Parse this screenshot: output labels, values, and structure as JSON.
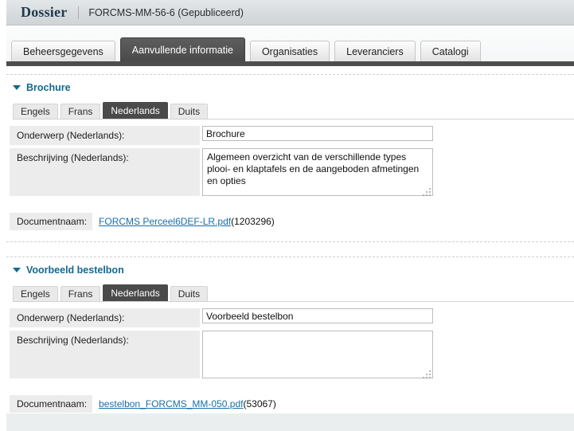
{
  "header": {
    "title": "Dossier",
    "subtitle": "FORCMS-MM-56-6 (Gepubliceerd)"
  },
  "tabs": [
    {
      "label": "Beheersgegevens",
      "active": false
    },
    {
      "label": "Aanvullende informatie",
      "active": true
    },
    {
      "label": "Organisaties",
      "active": false
    },
    {
      "label": "Leveranciers",
      "active": false
    },
    {
      "label": "Catalogi",
      "active": false
    }
  ],
  "language_tabs": [
    "Engels",
    "Frans",
    "Nederlands",
    "Duits"
  ],
  "active_language_tab": "Nederlands",
  "sections": [
    {
      "title": "Brochure",
      "langtabs": [
        "Engels",
        "Frans",
        "Nederlands",
        "Duits"
      ],
      "active_langtab": "Nederlands",
      "subject_label": "Onderwerp (Nederlands):",
      "subject_value": "Brochure",
      "description_label": "Beschrijving (Nederlands):",
      "description_value": "Algemeen overzicht van de verschillende types plooi- en klaptafels en de aangeboden afmetingen en opties",
      "document_label": "Documentnaam:",
      "document_link": "FORCMS Perceel6DEF-LR.pdf",
      "document_size": "(1203296)"
    },
    {
      "title": "Voorbeeld bestelbon",
      "langtabs": [
        "Engels",
        "Frans",
        "Nederlands",
        "Duits"
      ],
      "active_langtab": "Nederlands",
      "subject_label": "Onderwerp (Nederlands):",
      "subject_value": "Voorbeeld bestelbon",
      "description_label": "Beschrijving (Nederlands):",
      "description_value": "",
      "document_label": "Documentnaam:",
      "document_link": "bestelbon_FORCMS_MM-050.pdf",
      "document_size": "(53067)"
    }
  ],
  "colors": {
    "accent": "#15688f",
    "link": "#1a6ea8",
    "active_tab_bg": "#4a4a4a",
    "label_bg": "#ececec",
    "tabstrip_underline": "#4d4d4d"
  }
}
